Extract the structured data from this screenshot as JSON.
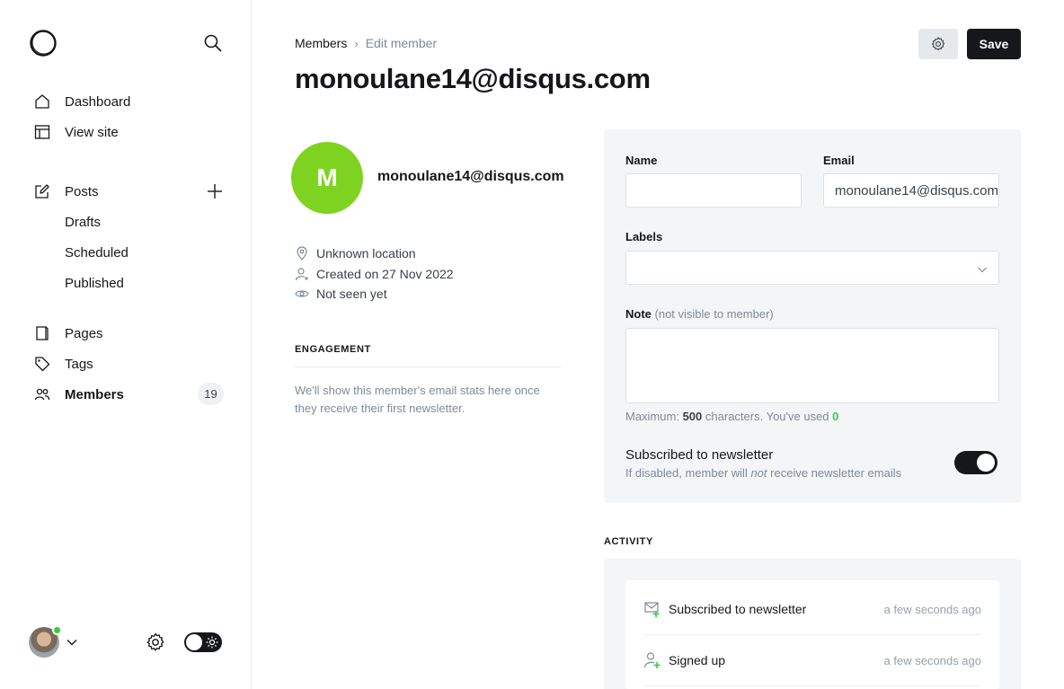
{
  "sidebar": {
    "nav": {
      "dashboard": "Dashboard",
      "view_site": "View site",
      "posts": "Posts",
      "drafts": "Drafts",
      "scheduled": "Scheduled",
      "published": "Published",
      "pages": "Pages",
      "tags": "Tags",
      "members": "Members"
    },
    "members_count": "19"
  },
  "header": {
    "breadcrumb_parent": "Members",
    "breadcrumb_separator": "›",
    "breadcrumb_current": "Edit member",
    "title": "monoulane14@disqus.com",
    "save_label": "Save"
  },
  "member": {
    "initial": "M",
    "email": "monoulane14@disqus.com",
    "avatar_color": "#7ed321",
    "location": "Unknown location",
    "created": "Created on 27 Nov 2022",
    "last_seen": "Not seen yet"
  },
  "engagement": {
    "heading": "ENGAGEMENT",
    "text": "We'll show this member's email stats here once they receive their first newsletter."
  },
  "form": {
    "name_label": "Name",
    "name_value": "",
    "email_label": "Email",
    "email_value": "monoulane14@disqus.com",
    "labels_label": "Labels",
    "note_label": "Note",
    "note_hint_label": "(not visible to member)",
    "note_value": "",
    "max_prefix": "Maximum:",
    "max_value": "500",
    "max_mid": "characters. You've used",
    "used_value": "0",
    "subscribed_title": "Subscribed to newsletter",
    "subscribed_desc_pre": "If disabled, member will",
    "subscribed_desc_em": "not",
    "subscribed_desc_post": "receive newsletter emails",
    "subscribed": true
  },
  "activity": {
    "heading": "ACTIVITY",
    "items": [
      {
        "text": "Subscribed to newsletter",
        "time": "a few seconds ago",
        "icon": "email-plus-icon"
      },
      {
        "text": "Signed up",
        "time": "a few seconds ago",
        "icon": "user-plus-icon"
      }
    ]
  },
  "colors": {
    "accent_green": "#30cf43",
    "dark": "#15171a",
    "panel_bg": "#f4f5f6"
  }
}
